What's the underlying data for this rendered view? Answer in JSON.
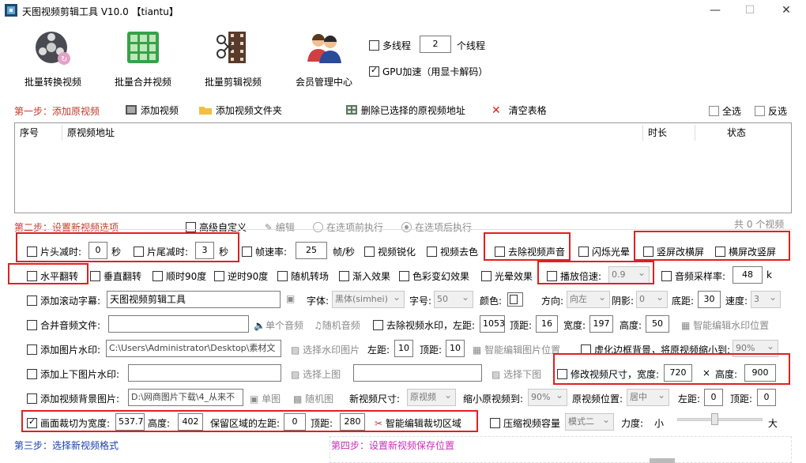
{
  "window": {
    "title": "天图视频剪辑工具 V10.0 【tiantu】",
    "min": "—",
    "max": "☐",
    "close": "✕"
  },
  "toolbar": {
    "convert": "批量转换视频",
    "merge": "批量合并视频",
    "clip": "批量剪辑视频",
    "member": "会员管理中心"
  },
  "options": {
    "multithread": "多线程",
    "threads": "2",
    "threads_unit": "个线程",
    "gpu": "GPU加速（用显卡解码）"
  },
  "step1": {
    "label": "第一步：添加原视频",
    "add_video": "添加视频",
    "add_folder": "添加视频文件夹",
    "delete_selected": "删除已选择的原视频地址",
    "clear_table": "清空表格",
    "select_all": "全选",
    "invert": "反选"
  },
  "table": {
    "columns": [
      "序号",
      "原视频地址",
      "时长",
      "状态"
    ]
  },
  "step2": {
    "label": "第二步：设置新视频选项",
    "advanced": "高级自定义",
    "edit": "编辑",
    "before": "在选项前执行",
    "after": "在选项后执行",
    "count": "共 0 个视频"
  },
  "row1": {
    "head_cut": "片头减时:",
    "head_val": "0",
    "sec1": "秒",
    "tail_cut": "片尾减时:",
    "tail_val": "3",
    "sec2": "秒",
    "framerate": "帧速率:",
    "framerate_val": "25",
    "fps_unit": "帧/秒",
    "sharpen": "视频锐化",
    "denoise": "视频去色",
    "remove_audio": "去除视频声音",
    "flash": "闪烁光晕",
    "v2h": "竖屏改横屏",
    "h2v": "横屏改竖屏"
  },
  "row2": {
    "hflip": "水平翻转",
    "vflip": "垂直翻转",
    "cw90": "顺时90度",
    "ccw90": "逆时90度",
    "random_trans": "随机转场",
    "fade_in": "渐入效果",
    "color_fx": "色彩变幻效果",
    "light_fx": "光晕效果",
    "speed": "播放倍速:",
    "speed_val": "0.9",
    "sample_rate": "音频采样率:",
    "sample_val": "48",
    "k": "k"
  },
  "row3": {
    "scroll_sub": "添加滚动字幕:",
    "sub_text": "天图视频剪辑工具",
    "font": "字体:",
    "font_val": "黑体(simhei)",
    "size": "字号:",
    "size_val": "50",
    "color": "颜色:",
    "direction": "方向:",
    "dir_val": "向左",
    "shadow": "阴影:",
    "shadow_val": "0",
    "bottom": "底距:",
    "bottom_val": "30",
    "speed": "速度:",
    "speed_val": "3"
  },
  "row4": {
    "merge_audio": "合并音频文件:",
    "single_audio": "单个音频",
    "random_audio": "随机音频",
    "remove_wm": "去除视频水印，左距:",
    "left_val": "1053",
    "top": "顶距:",
    "top_val": "16",
    "width": "宽度:",
    "width_val": "197",
    "height": "高度:",
    "height_val": "50",
    "smart_wm": "智能编辑水印位置"
  },
  "row5": {
    "img_wm": "添加图片水印:",
    "path": "C:\\Users\\Administrator\\Desktop\\素材文",
    "choose_img": "选择水印图片",
    "left": "左距:",
    "left_val": "10",
    "top": "顶距:",
    "top_val": "10",
    "smart_img": "智能编辑图片位置",
    "blur_bg": "虚化边框背景，将原视频缩小到:",
    "blur_val": "90%"
  },
  "row6": {
    "tb_wm": "添加上下图片水印:",
    "choose_top": "选择上图",
    "choose_bottom": "选择下图",
    "resize": "修改视频尺寸，宽度:",
    "w_val": "720",
    "x": "×",
    "h_label": "高度:",
    "h_val": "900"
  },
  "row7": {
    "bg_img": "添加视频背景图片:",
    "bg_path": "D:\\网商图片下载\\4_从来不",
    "single": "单图",
    "random": "随机图",
    "new_size": "新视频尺寸:",
    "new_size_val": "原视频",
    "shrink": "缩小原视频到:",
    "shrink_val": "90%",
    "pos": "原视频位置:",
    "pos_val": "居中",
    "left": "左距:",
    "left_val": "0",
    "top": "顶距:",
    "top_val": "0"
  },
  "row8": {
    "crop": "画面裁切为宽度:",
    "crop_w": "537.77",
    "height": "高度:",
    "crop_h": "402",
    "keep_left": "保留区域的左距:",
    "left_val": "0",
    "top": "顶距:",
    "top_val": "280",
    "smart_crop": "智能编辑裁切区域",
    "compress": "压缩视频容量",
    "mode_val": "模式二",
    "strength": "力度:",
    "small": "小",
    "big": "大"
  },
  "step3": {
    "label": "第三步：选择新视频格式"
  },
  "step4": {
    "label": "第四步：设置新视频保存位置"
  },
  "colors": {
    "step_red": "#c0392b",
    "step_blue": "#1b3fa8",
    "step_pink": "#c830b8",
    "highlight": "#e02020"
  }
}
